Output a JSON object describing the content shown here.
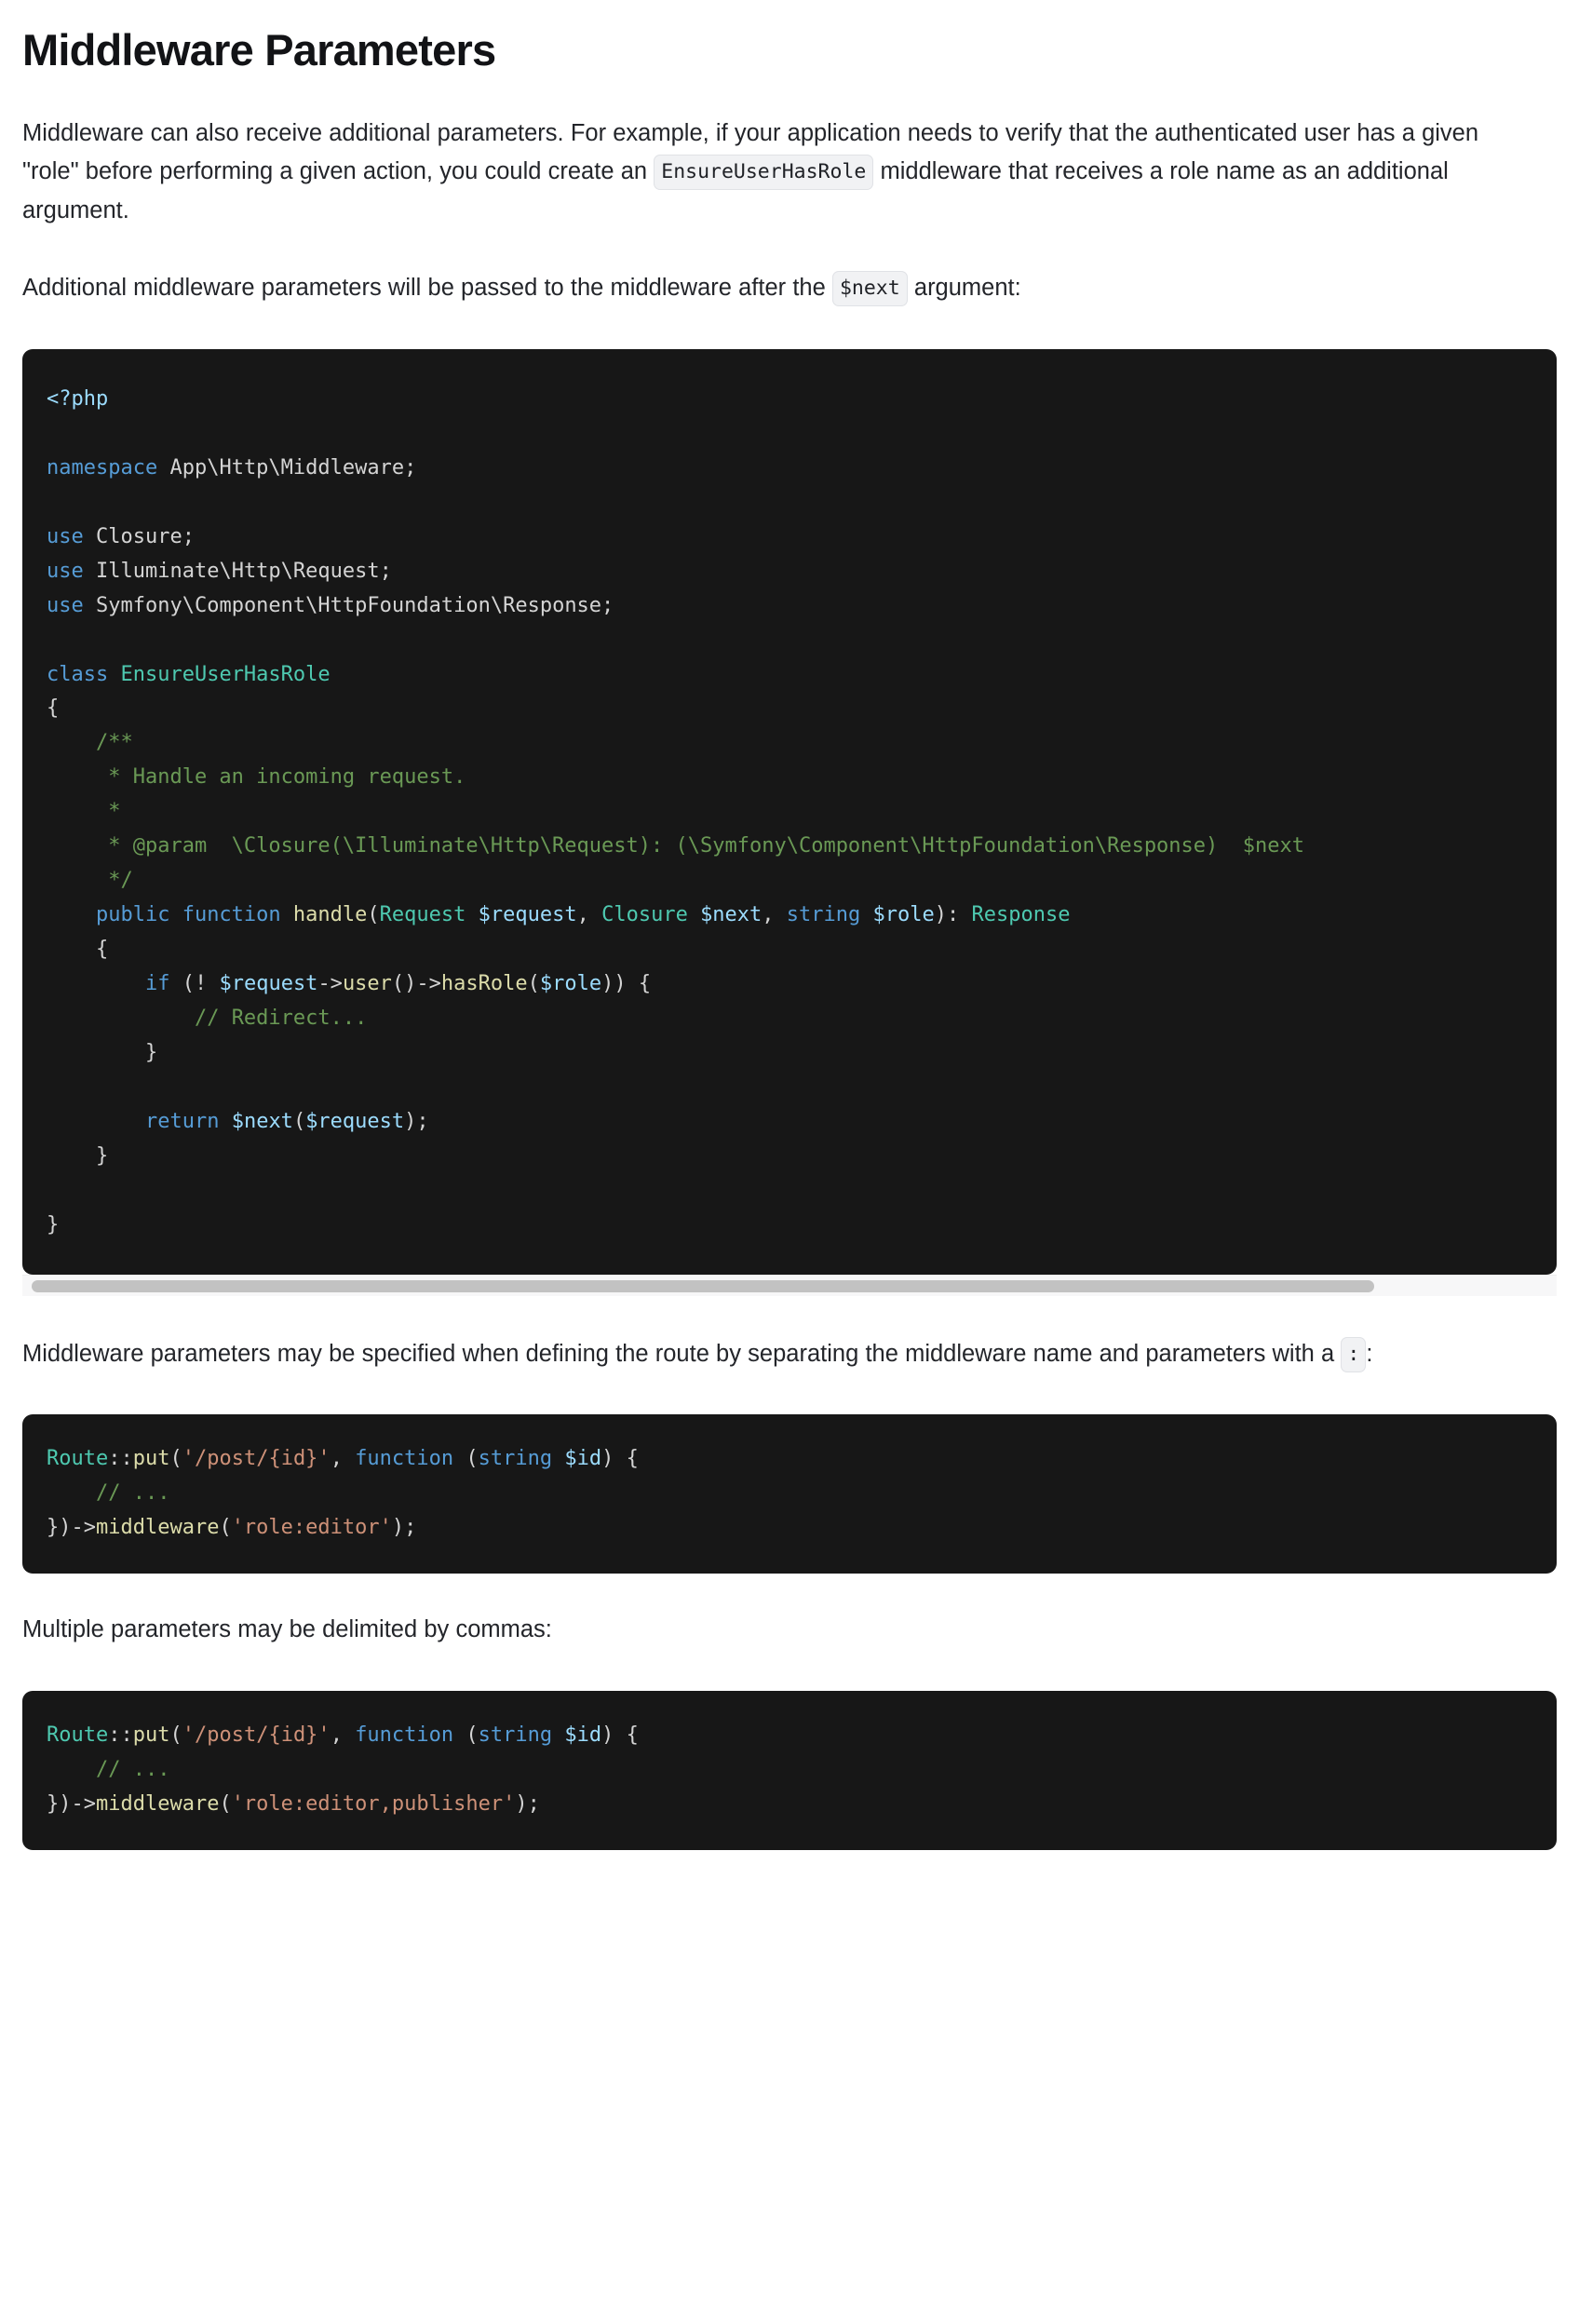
{
  "page": {
    "title": "Middleware Parameters",
    "background": "#ffffff",
    "text_color": "#23252a",
    "heading_color": "#121316"
  },
  "paragraphs": {
    "intro_part1": "Middleware can also receive additional parameters. For example, if your application needs to verify that the authenticated user has a given \"role\" before performing a given action, you could create an ",
    "intro_code": "EnsureUserHasRole",
    "intro_part2": " middleware that receives a role name as an additional argument.",
    "second_part1": "Additional middleware parameters will be passed to the middleware after the ",
    "second_code": "$next",
    "second_part2": " argument:",
    "third_part1": "Middleware parameters may be specified when defining the route by separating the middleware name and parameters with a ",
    "third_code": ":",
    "third_part2": ":",
    "fourth": "Multiple parameters may be delimited by commas:"
  },
  "code_blocks": {
    "middleware_class": {
      "language": "php",
      "background": "#171717",
      "has_horizontal_scrollbar": true,
      "scroll_thumb_width_percent": 87.5,
      "lines": [
        "<?php",
        "",
        "namespace App\\Http\\Middleware;",
        "",
        "use Closure;",
        "use Illuminate\\Http\\Request;",
        "use Symfony\\Component\\HttpFoundation\\Response;",
        "",
        "class EnsureUserHasRole",
        "{",
        "    /**",
        "     * Handle an incoming request.",
        "     *",
        "     * @param  \\Closure(\\Illuminate\\Http\\Request): (\\Symfony\\Component\\HttpFoundation\\Response)  $next",
        "     */",
        "    public function handle(Request $request, Closure $next, string $role): Response",
        "    {",
        "        if (! $request->user()->hasRole($role)) {",
        "            // Redirect...",
        "        }",
        "",
        "        return $next($request);",
        "    }",
        "",
        "}"
      ]
    },
    "route_single_param": {
      "language": "php",
      "background": "#171717",
      "has_horizontal_scrollbar": false,
      "lines": [
        "Route::put('/post/{id}', function (string $id) {",
        "    // ...",
        "})->middleware('role:editor');"
      ]
    },
    "route_multiple_params": {
      "language": "php",
      "background": "#171717",
      "has_horizontal_scrollbar": false,
      "lines": [
        "Route::put('/post/{id}', function (string $id) {",
        "    // ...",
        "})->middleware('role:editor,publisher');"
      ]
    }
  },
  "syntax_colors": {
    "keyword": "#569cd6",
    "type": "#4ec9b0",
    "function": "#dcdcaa",
    "variable": "#9cdcfe",
    "string": "#ce9178",
    "comment": "#6a9955",
    "plain": "#d4d4d4"
  }
}
